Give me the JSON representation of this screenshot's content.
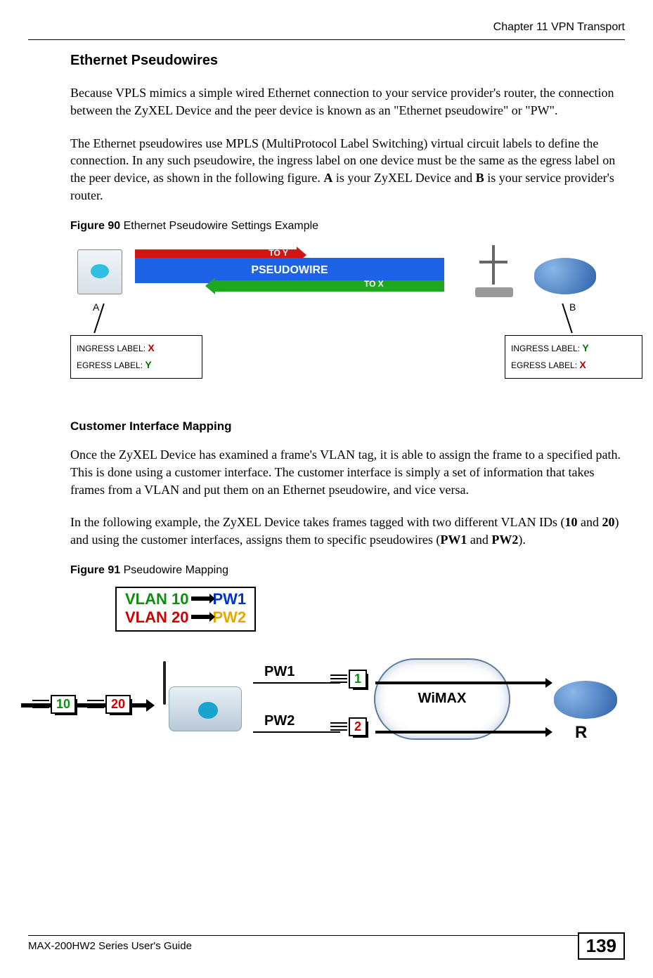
{
  "header": {
    "chapter": "Chapter 11 VPN Transport"
  },
  "sec1": {
    "title": "Ethernet Pseudowires",
    "p1": "Because VPLS mimics a simple wired Ethernet connection to your service provider's router, the connection between the ZyXEL Device and the peer device is known as an \"Ethernet pseudowire\" or \"PW\".",
    "p2_a": "The Ethernet pseudowires use MPLS (MultiProtocol Label Switching) virtual circuit labels to define the connection. In any such pseudowire, the ingress label on one device must be the same as the egress label on the peer device, as shown in the following figure. ",
    "p2_b": "A",
    "p2_c": " is your ZyXEL Device and ",
    "p2_d": "B",
    "p2_e": " is your service provider's router."
  },
  "fig90": {
    "caption_num": "Figure 90",
    "caption_txt": "   Ethernet Pseudowire Settings Example",
    "to_y": "TO   Y",
    "to_x": "TO   X",
    "pw": "PSEUDOWIRE",
    "a": "A",
    "b": "B",
    "ingress": "INGRESS LABEL: ",
    "egress": "EGRESS LABEL: ",
    "X": "X",
    "Y": "Y"
  },
  "sec2": {
    "title": "Customer Interface Mapping",
    "p1": "Once the ZyXEL Device has examined a frame's VLAN tag, it is able to assign the frame to a specified path. This is done using a customer interface. The customer interface is simply a set of information that takes frames from a VLAN and put them on an Ethernet pseudowire, and vice versa.",
    "p2_a": "In the following example, the ZyXEL Device takes frames tagged with two different VLAN IDs (",
    "p2_b": "10",
    "p2_c": " and ",
    "p2_d": "20",
    "p2_e": ") and using the customer interfaces, assigns them to specific pseudowires (",
    "p2_f": "PW1",
    "p2_g": " and ",
    "p2_h": "PW2",
    "p2_i": ")."
  },
  "fig91": {
    "caption_num": "Figure 91",
    "caption_txt": "   Pseudowire Mapping",
    "vlan10": "VLAN 10",
    "pw1": "PW1",
    "vlan20": "VLAN 20",
    "pw2": "PW2",
    "tag10": "10",
    "tag20": "20",
    "tagpw1": "1",
    "tagpw2": "2",
    "wimax": "WiMAX",
    "r": "R"
  },
  "footer": {
    "guide": "MAX-200HW2 Series User's Guide",
    "page": "139"
  }
}
